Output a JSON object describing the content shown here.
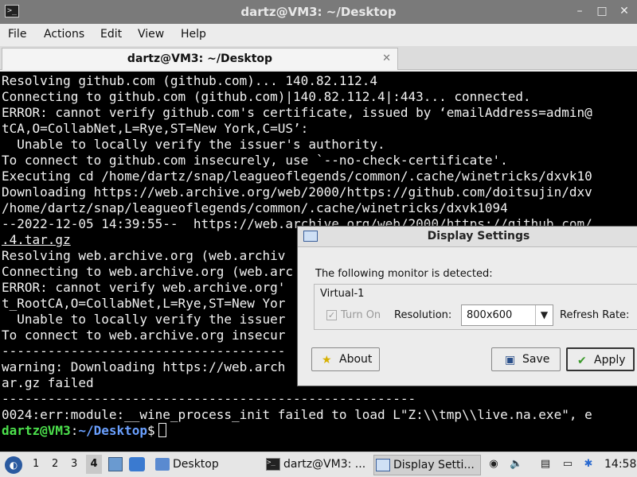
{
  "terminal": {
    "title": "dartz@VM3: ~/Desktop",
    "tab_label": "dartz@VM3: ~/Desktop",
    "menu": [
      "File",
      "Actions",
      "Edit",
      "View",
      "Help"
    ],
    "lines": [
      "Resolving github.com (github.com)... 140.82.112.4",
      "Connecting to github.com (github.com)|140.82.112.4|:443... connected.",
      "ERROR: cannot verify github.com's certificate, issued by ‘emailAddress=admin@",
      "tCA,O=CollabNet,L=Rye,ST=New York,C=US’:",
      "  Unable to locally verify the issuer's authority.",
      "To connect to github.com insecurely, use `--no-check-certificate'.",
      "Executing cd /home/dartz/snap/leagueoflegends/common/.cache/winetricks/dxvk10",
      "Downloading https://web.archive.org/web/2000/https://github.com/doitsujin/dxv",
      "/home/dartz/snap/leagueoflegends/common/.cache/winetricks/dxvk1094",
      "--2022-12-05 14:39:55--  https://web.archive.org/web/2000/https://github.com/",
      ".4.tar.gz",
      "Resolving web.archive.org (web.archiv",
      "Connecting to web.archive.org (web.arc",
      "ERROR: cannot verify web.archive.org'",
      "t_RootCA,O=CollabNet,L=Rye,ST=New Yor",
      "  Unable to locally verify the issuer",
      "To connect to web.archive.org insecur",
      "-------------------------------------",
      "warning: Downloading https://web.arch",
      "ar.gz failed",
      "------------------------------------------------------",
      "0024:err:module:__wine_process_init failed to load L\"Z:\\\\tmp\\\\live.na.exe\", e"
    ],
    "prompt_user": "dartz@VM3",
    "prompt_sep": ":",
    "prompt_path": "~/Desktop",
    "prompt_end": "$"
  },
  "dialog": {
    "title": "Display Settings",
    "message": "The following monitor is detected:",
    "monitor_name": "Virtual-1",
    "turn_on_label": "Turn On",
    "turn_on_checked": true,
    "resolution_label": "Resolution:",
    "resolution_value": "800x600",
    "refresh_label": "Refresh Rate:",
    "about_label": "About",
    "save_label": "Save",
    "apply_label": "Apply"
  },
  "taskbar": {
    "workspaces": [
      "1",
      "2",
      "3",
      "4"
    ],
    "active_workspace": "4",
    "desktop_label": "Desktop",
    "tasks": [
      {
        "label": "dartz@VM3: ..."
      },
      {
        "label": "Display Setti..."
      }
    ],
    "clock": "14:58"
  }
}
